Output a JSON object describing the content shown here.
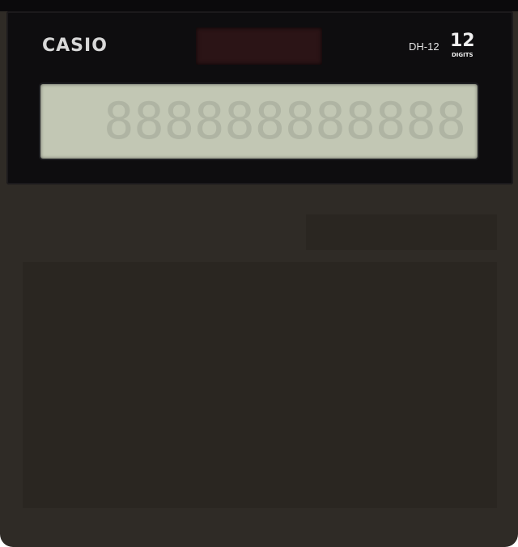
{
  "device": {
    "brand": "CASIO",
    "model": "DH-12",
    "digits_count": "12",
    "digits_label": "DIGITS",
    "display_value": "888888888888"
  },
  "colors": {
    "body": "#2f2b26",
    "face_panel": "#0e0d0f",
    "lcd": "#c2c7b4",
    "solar_cell": "#2b1416",
    "redacted_block": "#2a2621"
  }
}
